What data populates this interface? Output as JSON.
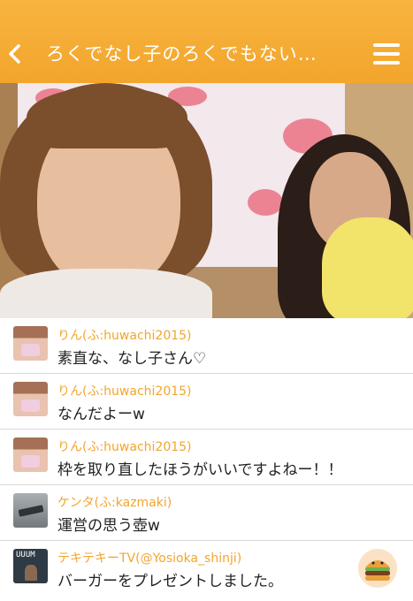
{
  "header": {
    "title": "ろくでなし子のろくでもない…",
    "back_icon": "chevron-left-icon",
    "menu_icon": "hamburger-menu-icon",
    "background_color": "#f3a52c"
  },
  "comments": [
    {
      "user": "りん(ふ:huwachi2015)",
      "message": "素直な、なし子さん♡",
      "avatar": "user-avatar"
    },
    {
      "user": "りん(ふ:huwachi2015)",
      "message": "なんだよーw",
      "avatar": "user-avatar"
    },
    {
      "user": "りん(ふ:huwachi2015)",
      "message": "枠を取り直したほうがいいですよねー！！",
      "avatar": "user-avatar"
    },
    {
      "user": "ケンタ(ふ:kazmaki)",
      "message": "運営の思う壺w",
      "avatar": "user-avatar"
    },
    {
      "user": "テキテキーTV(@Yosioka_shinji)",
      "message": "バーガーをプレゼントしました。",
      "avatar": "user-avatar",
      "avatar_text": "UUUM",
      "gift_icon": "hamburger-gift-icon"
    }
  ],
  "colors": {
    "accent": "#f3a52c",
    "username": "#f3a52c",
    "message": "#222222"
  }
}
